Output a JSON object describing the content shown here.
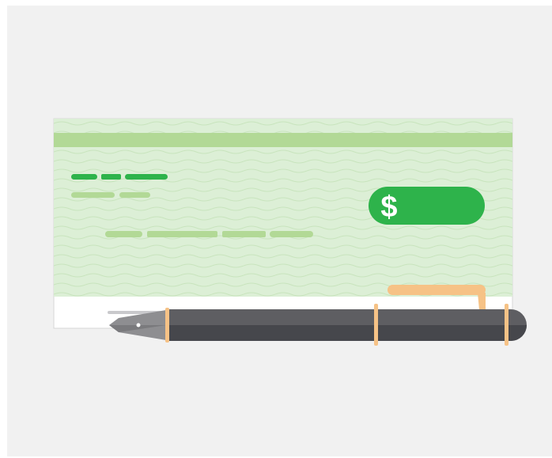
{
  "illustration": {
    "subject": "check-and-fountain-pen",
    "icons": [
      "dollar-sign-icon",
      "fountain-pen-icon"
    ],
    "amount_symbol": "$"
  },
  "colors": {
    "background": "#f1f1f1",
    "check_paper": "#dcefd6",
    "check_band": "#b2d996",
    "check_wave": "#c8e4bd",
    "accent_green": "#2eb34b",
    "placeholder_line": "#b2d996",
    "pen_body": "#5e5e62",
    "pen_body_dark": "#46474c",
    "pen_band": "#f6c286",
    "pen_nib": "#8e8e91"
  }
}
